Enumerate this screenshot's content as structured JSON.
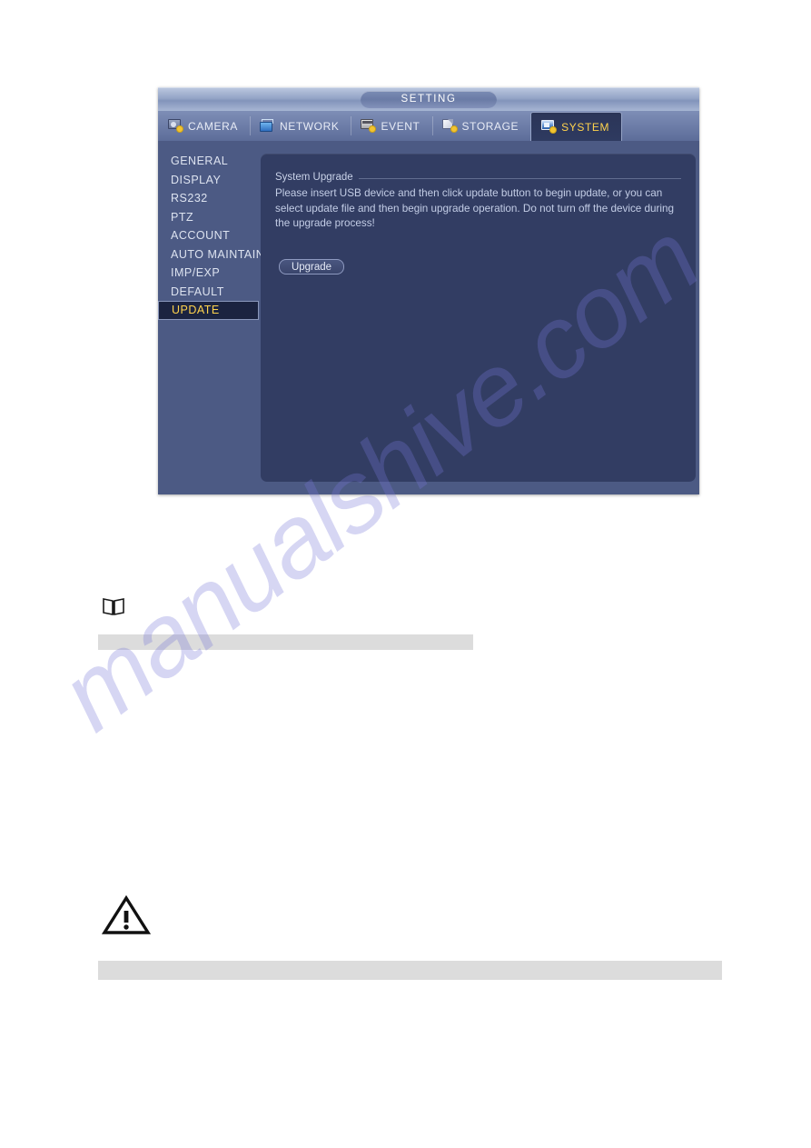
{
  "dialog": {
    "title": "SETTING",
    "tabs": [
      {
        "label": "CAMERA",
        "icon": "camera-icon",
        "active": false
      },
      {
        "label": "NETWORK",
        "icon": "network-icon",
        "active": false
      },
      {
        "label": "EVENT",
        "icon": "event-icon",
        "active": false
      },
      {
        "label": "STORAGE",
        "icon": "storage-icon",
        "active": false
      },
      {
        "label": "SYSTEM",
        "icon": "system-icon",
        "active": true
      }
    ],
    "sidebar": {
      "items": [
        {
          "label": "GENERAL",
          "selected": false
        },
        {
          "label": "DISPLAY",
          "selected": false
        },
        {
          "label": "RS232",
          "selected": false
        },
        {
          "label": "PTZ",
          "selected": false
        },
        {
          "label": "ACCOUNT",
          "selected": false
        },
        {
          "label": "AUTO MAINTAIN",
          "selected": false
        },
        {
          "label": "IMP/EXP",
          "selected": false
        },
        {
          "label": "DEFAULT",
          "selected": false
        },
        {
          "label": "UPDATE",
          "selected": true
        }
      ]
    },
    "content": {
      "section_title": "System Upgrade",
      "description": "Please insert USB device and then click update button to begin update, or you can select update file and then begin upgrade operation. Do not turn off the device during the upgrade process!",
      "upgrade_button_label": "Upgrade"
    }
  },
  "document": {
    "watermark": "manualshive.com",
    "note_icon": "book-icon",
    "warning_icon": "warning-triangle-icon"
  },
  "colors": {
    "dialog_background": "#4c5a84",
    "content_panel": "#323d63",
    "active_tab": "#2b3558",
    "accent_yellow": "#ffd34d",
    "titlebar_top": "#b9c5de",
    "grey_bar": "#dcdcdc",
    "watermark": "#7878d7"
  }
}
